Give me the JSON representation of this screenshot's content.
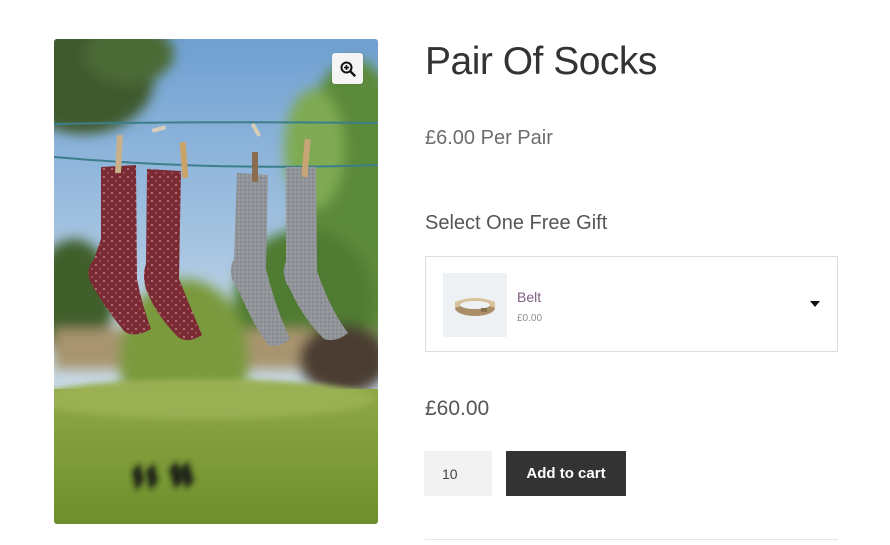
{
  "product": {
    "title": "Pair Of Socks",
    "subtitle": "£6.00 Per Pair",
    "price": "£60.00"
  },
  "gift": {
    "heading": "Select One Free Gift",
    "selected_name": "Belt",
    "selected_price": "£0.00"
  },
  "cart": {
    "quantity": "10",
    "add_label": "Add to cart"
  },
  "icons": {
    "zoom": "zoom-in-icon",
    "dropdown": "caret-down-icon",
    "thumbnail": "belt-image"
  },
  "colors": {
    "button_bg": "#333333",
    "gift_link": "#7f5d7f",
    "sock_red": "#7b2b34",
    "sock_grey": "#8f9296"
  }
}
